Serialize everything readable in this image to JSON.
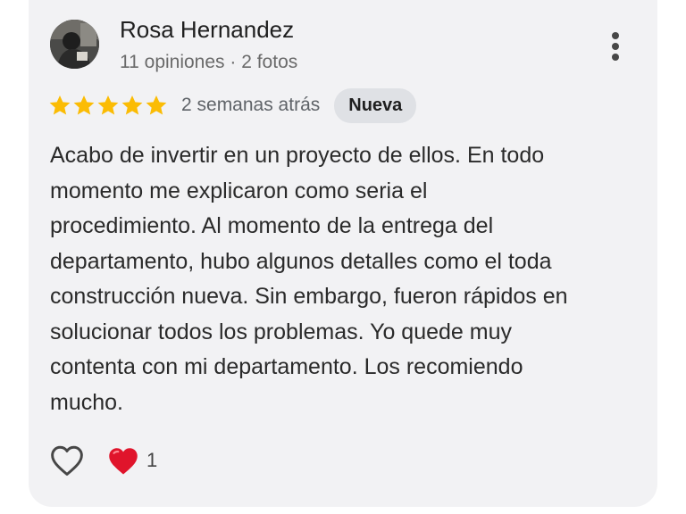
{
  "review": {
    "author": {
      "name": "Rosa Hernandez",
      "meta": "11 opiniones · 2 fotos"
    },
    "rating": 5,
    "date": "2 semanas atrás",
    "badge": "Nueva",
    "text": "Acabo de invertir en un proyecto de ellos. En todo\nmomento me explicaron como seria el\nprocedimiento. Al momento de la entrega del\ndepartamento, hubo algunos detalles como el toda\nconstrucción nueva. Sin embargo, fueron rápidos en\nsolucionar todos los problemas. Yo quede muy\ncontenta con mi departamento. Los recomiendo\nmucho.",
    "reactions": {
      "heart_count": "1"
    }
  },
  "icons": {
    "menu": "more-vert-icon",
    "star": "star-icon",
    "like": "heart-outline-icon",
    "reaction": "red-heart-emoji-icon"
  },
  "colors": {
    "card_background": "#f2f2f4",
    "star": "#fbbc04",
    "badge_background": "#dfe1e5",
    "heart": "#e0142b"
  }
}
